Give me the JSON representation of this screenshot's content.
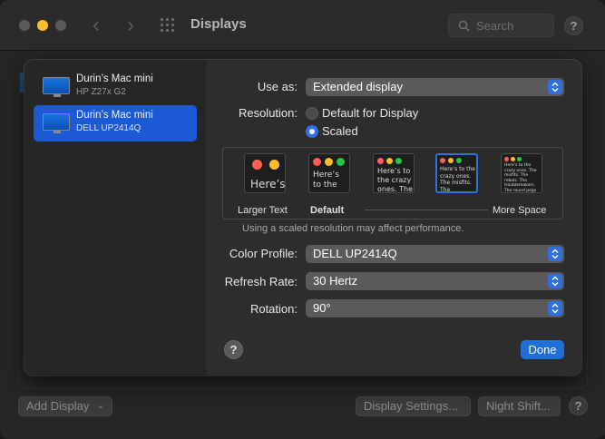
{
  "window": {
    "title": "Displays",
    "search_placeholder": "Search",
    "add_display_label": "Add Display",
    "display_settings_label": "Display Settings...",
    "night_shift_label": "Night Shift...",
    "help_label": "?"
  },
  "sidebar": {
    "displays": [
      {
        "name": "Durin’s Mac mini",
        "model": "HP Z27x G2",
        "selected": false
      },
      {
        "name": "Durin’s Mac mini",
        "model": "DELL UP2414Q",
        "selected": true
      }
    ]
  },
  "settings": {
    "use_as_label": "Use as:",
    "use_as_value": "Extended display",
    "resolution_label": "Resolution:",
    "resolution_options": [
      "Default for Display",
      "Scaled"
    ],
    "resolution_selected": "Scaled",
    "scale_previews": [
      {
        "preview_text": "Here’s"
      },
      {
        "preview_text": "Here’s to the crazy ones. The misfits"
      },
      {
        "preview_text": "Here’s to the crazy ones. The misfits"
      },
      {
        "preview_text": "Here’s to the crazy ones. The misfits. The troublemakers. The round pegs in the square holes. The ones who see things differently. They’re not fond of rules. And they"
      },
      {
        "preview_text": "Here’s to the crazy ones. The misfits. The rebels. The troublemakers. The round pegs in the square holes. The ones who see things differently. They’re not fond of rules. And they have no respect for the status quo. You can quote them, disagree with them, glorify or vilify them. About the only thing you can’t do is ignore them."
      }
    ],
    "scale_selected_index": 3,
    "scale_left_caption": "Larger Text",
    "scale_default_caption": "Default",
    "scale_right_caption": "More Space",
    "performance_note": "Using a scaled resolution may affect performance.",
    "color_profile_label": "Color Profile:",
    "color_profile_value": "DELL UP2414Q",
    "refresh_rate_label": "Refresh Rate:",
    "refresh_rate_value": "30 Hertz",
    "rotation_label": "Rotation:",
    "rotation_value": "90°",
    "help_label": "?",
    "done_label": "Done"
  },
  "colors": {
    "accent": "#2f6fe0",
    "traffic_close": "#ff5f57",
    "traffic_min": "#febc2e",
    "traffic_max": "#c1c1c1"
  }
}
